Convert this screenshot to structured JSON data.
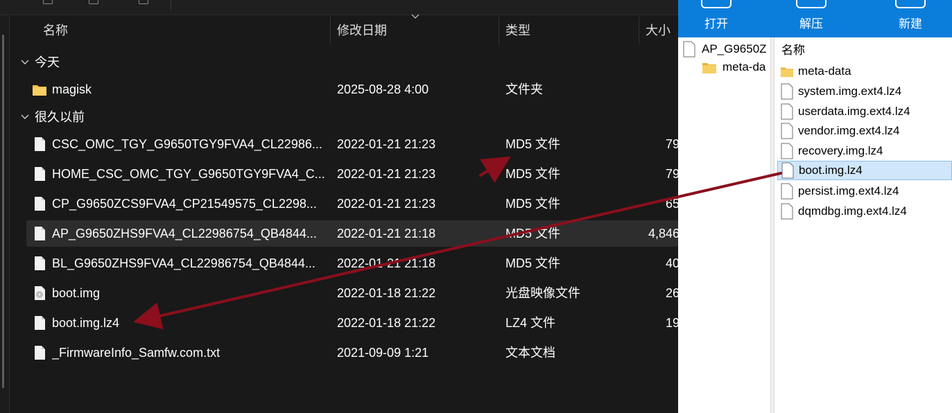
{
  "explorer": {
    "columns": {
      "name": "名称",
      "modified": "修改日期",
      "type": "类型",
      "size": "大小"
    },
    "groups": [
      {
        "label": "今天"
      },
      {
        "label": "很久以前"
      }
    ],
    "rows": [
      {
        "name": "magisk",
        "date": "2025-08-28 4:00",
        "type": "文件夹",
        "size": "",
        "icon": "folder-icon"
      },
      {
        "name": "CSC_OMC_TGY_G9650TGY9FVA4_CL22986...",
        "date": "2022-01-21 21:23",
        "type": "MD5 文件",
        "size": "79",
        "icon": "file-icon"
      },
      {
        "name": "HOME_CSC_OMC_TGY_G9650TGY9FVA4_C...",
        "date": "2022-01-21 21:23",
        "type": "MD5 文件",
        "size": "79",
        "icon": "file-icon"
      },
      {
        "name": "CP_G9650ZCS9FVA4_CP21549575_CL2298...",
        "date": "2022-01-21 21:23",
        "type": "MD5 文件",
        "size": "65",
        "icon": "file-icon"
      },
      {
        "name": "AP_G9650ZHS9FVA4_CL22986754_QB4844...",
        "date": "2022-01-21 21:18",
        "type": "MD5 文件",
        "size": "4,846",
        "icon": "file-icon",
        "selected": true
      },
      {
        "name": "BL_G9650ZHS9FVA4_CL22986754_QB4844...",
        "date": "2022-01-21 21:18",
        "type": "MD5 文件",
        "size": "40",
        "icon": "file-icon"
      },
      {
        "name": "boot.img",
        "date": "2022-01-18 21:22",
        "type": "光盘映像文件",
        "size": "26",
        "icon": "disc-image-icon"
      },
      {
        "name": "boot.img.lz4",
        "date": "2022-01-18 21:22",
        "type": "LZ4 文件",
        "size": "19",
        "icon": "file-icon"
      },
      {
        "name": "_FirmwareInfo_Samfw.com.txt",
        "date": "2021-09-09 1:21",
        "type": "文本文档",
        "size": "",
        "icon": "text-file-icon"
      }
    ]
  },
  "archive": {
    "toolbar": {
      "open": "打开",
      "extract": "解压",
      "new": "新建"
    },
    "tree": {
      "root": "AP_G9650Z",
      "child": "meta-da"
    },
    "header": "名称",
    "files": [
      {
        "name": "meta-data",
        "icon": "folder-icon"
      },
      {
        "name": "system.img.ext4.lz4",
        "icon": "file-icon"
      },
      {
        "name": "userdata.img.ext4.lz4",
        "icon": "file-icon"
      },
      {
        "name": "vendor.img.ext4.lz4",
        "icon": "file-icon"
      },
      {
        "name": "recovery.img.lz4",
        "icon": "file-icon"
      },
      {
        "name": "boot.img.lz4",
        "icon": "file-icon",
        "selected": true
      },
      {
        "name": "persist.img.ext4.lz4",
        "icon": "file-icon"
      },
      {
        "name": "dqmdbg.img.ext4.lz4",
        "icon": "file-icon"
      }
    ]
  },
  "colors": {
    "explorer_bg": "#191919",
    "selected_row": "#2d2d2d",
    "ribbon_blue": "#0b7ddb",
    "archive_selected": "#cfe6fb",
    "annotation_arrow": "#8b0f1c",
    "folder": "#f4c04a"
  }
}
